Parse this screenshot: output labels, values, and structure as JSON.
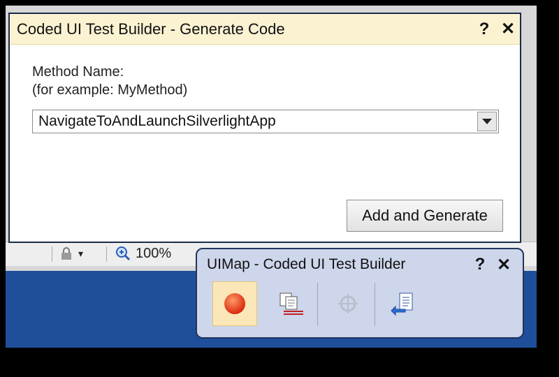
{
  "dialog": {
    "title": "Coded UI Test Builder - Generate Code",
    "help_label": "?",
    "close_label": "✕",
    "method_label": "Method Name:",
    "example_label": "(for example: MyMethod)",
    "method_value": "NavigateToAndLaunchSilverlightApp",
    "add_button": "Add and Generate"
  },
  "statusbar": {
    "zoom": "100%",
    "dropdown_glyph": "▾"
  },
  "uimap": {
    "title": "UIMap - Coded UI Test Builder",
    "help_label": "?",
    "close_label": "✕",
    "tools": [
      {
        "icon": "record-icon"
      },
      {
        "icon": "show-recorded-steps-icon"
      },
      {
        "icon": "crosshair-assertion-icon"
      },
      {
        "icon": "generate-code-icon"
      }
    ]
  },
  "colors": {
    "dialog_title_bg": "#fbf2d2",
    "toolbar_bg": "#cdd6ea",
    "desktop_blue": "#1f4f9a"
  }
}
